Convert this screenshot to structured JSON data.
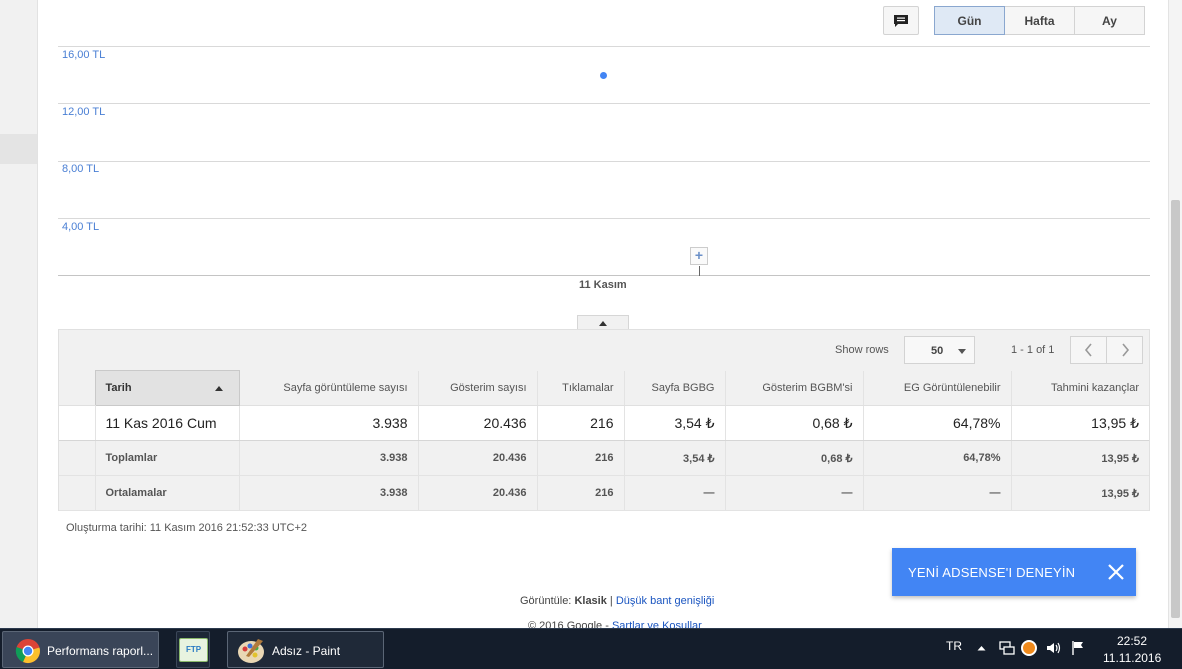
{
  "toolbar": {
    "periods": [
      "Gün",
      "Hafta",
      "Ay"
    ],
    "active_period": "Gün"
  },
  "chart_data": {
    "type": "line",
    "y_ticks": [
      "16,00 TL",
      "12,00 TL",
      "8,00 TL",
      "4,00 TL"
    ],
    "ylim": [
      0,
      16
    ],
    "categories": [
      "11 Kasım"
    ],
    "series": [
      {
        "values": [
          13.95
        ]
      }
    ],
    "grid": true
  },
  "table": {
    "show_rows_label": "Show rows",
    "rows_value": "50",
    "page_info": "1 - 1 of 1",
    "columns": [
      "Tarih",
      "Sayfa görüntüleme sayısı",
      "Gösterim sayısı",
      "Tıklamalar",
      "Sayfa BGBG",
      "Gösterim BGBM'si",
      "EG Görüntülenebilir",
      "Tahmini kazançlar"
    ],
    "data_row": [
      "11 Kas 2016 Cum",
      "3.938",
      "20.436",
      "216",
      "3,54 ₺",
      "0,68 ₺",
      "64,78%",
      "13,95 ₺"
    ],
    "totals_row": [
      "Toplamlar",
      "3.938",
      "20.436",
      "216",
      "3,54 ₺",
      "0,68 ₺",
      "64,78%",
      "13,95 ₺"
    ],
    "averages_row": [
      "Ortalamalar",
      "3.938",
      "20.436",
      "216",
      "—",
      "—",
      "—",
      "13,95 ₺"
    ]
  },
  "footer": {
    "created": "Oluşturma tarihi: 11 Kasım 2016 21:52:33 UTC+2",
    "view_prefix": "Görüntüle:",
    "view_current": "Klasik",
    "view_sep": "|",
    "view_link": "Düşük bant genişliği",
    "copyright": "© 2016 Google -",
    "terms_link": "Şartlar ve Koşullar"
  },
  "toast": {
    "message": "YENİ ADSENSE'I DENEYİN"
  },
  "taskbar": {
    "chrome_title": "Performans raporl...",
    "paint_title": "Adsız - Paint",
    "ftp_label": "FTP",
    "lang": "TR",
    "time": "22:52",
    "date": "11.11.2016"
  },
  "colors": {
    "accent": "#4285f4",
    "axis_text": "#4a7fd4",
    "taskbar": "#141d2b"
  }
}
